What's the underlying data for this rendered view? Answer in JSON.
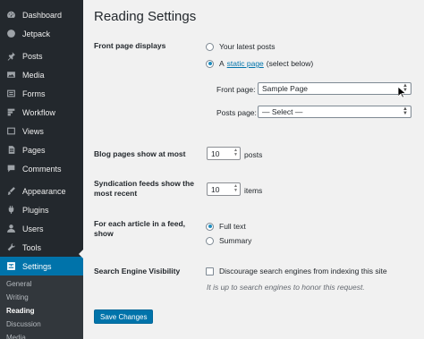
{
  "sidebar": {
    "items": [
      {
        "label": "Dashboard",
        "icon": "dashboard-icon"
      },
      {
        "label": "Jetpack",
        "icon": "jetpack-icon"
      },
      {
        "label": "Posts",
        "icon": "pin-icon"
      },
      {
        "label": "Media",
        "icon": "media-icon"
      },
      {
        "label": "Forms",
        "icon": "forms-icon"
      },
      {
        "label": "Workflow",
        "icon": "workflow-icon"
      },
      {
        "label": "Views",
        "icon": "views-icon"
      },
      {
        "label": "Pages",
        "icon": "pages-icon"
      },
      {
        "label": "Comments",
        "icon": "comments-icon"
      },
      {
        "label": "Appearance",
        "icon": "brush-icon"
      },
      {
        "label": "Plugins",
        "icon": "plugin-icon"
      },
      {
        "label": "Users",
        "icon": "users-icon"
      },
      {
        "label": "Tools",
        "icon": "wrench-icon"
      },
      {
        "label": "Settings",
        "icon": "settings-icon"
      }
    ],
    "submenu": [
      "General",
      "Writing",
      "Reading",
      "Discussion",
      "Media"
    ],
    "current_submenu": "Reading",
    "accent_color": "#0073aa"
  },
  "page": {
    "title": "Reading Settings"
  },
  "front_page": {
    "label": "Front page displays",
    "option_latest": "Your latest posts",
    "option_static_prefix": "A",
    "option_static_link": "static page",
    "option_static_suffix": "(select below)",
    "selected": "static page",
    "front_page_label": "Front page:",
    "front_page_value": "Sample Page",
    "posts_page_label": "Posts page:",
    "posts_page_value": "— Select —"
  },
  "blog_pages": {
    "label": "Blog pages show at most",
    "value": "10",
    "unit": "posts"
  },
  "syndication": {
    "label": "Syndication feeds show the most recent",
    "value": "10",
    "unit": "items"
  },
  "feed_article": {
    "label": "For each article in a feed, show",
    "option_full": "Full text",
    "option_summary": "Summary",
    "selected": "Full text"
  },
  "search_engine": {
    "label": "Search Engine Visibility",
    "checkbox_label": "Discourage search engines from indexing this site",
    "checked": false,
    "description": "It is up to search engines to honor this request."
  },
  "actions": {
    "save_label": "Save Changes"
  }
}
